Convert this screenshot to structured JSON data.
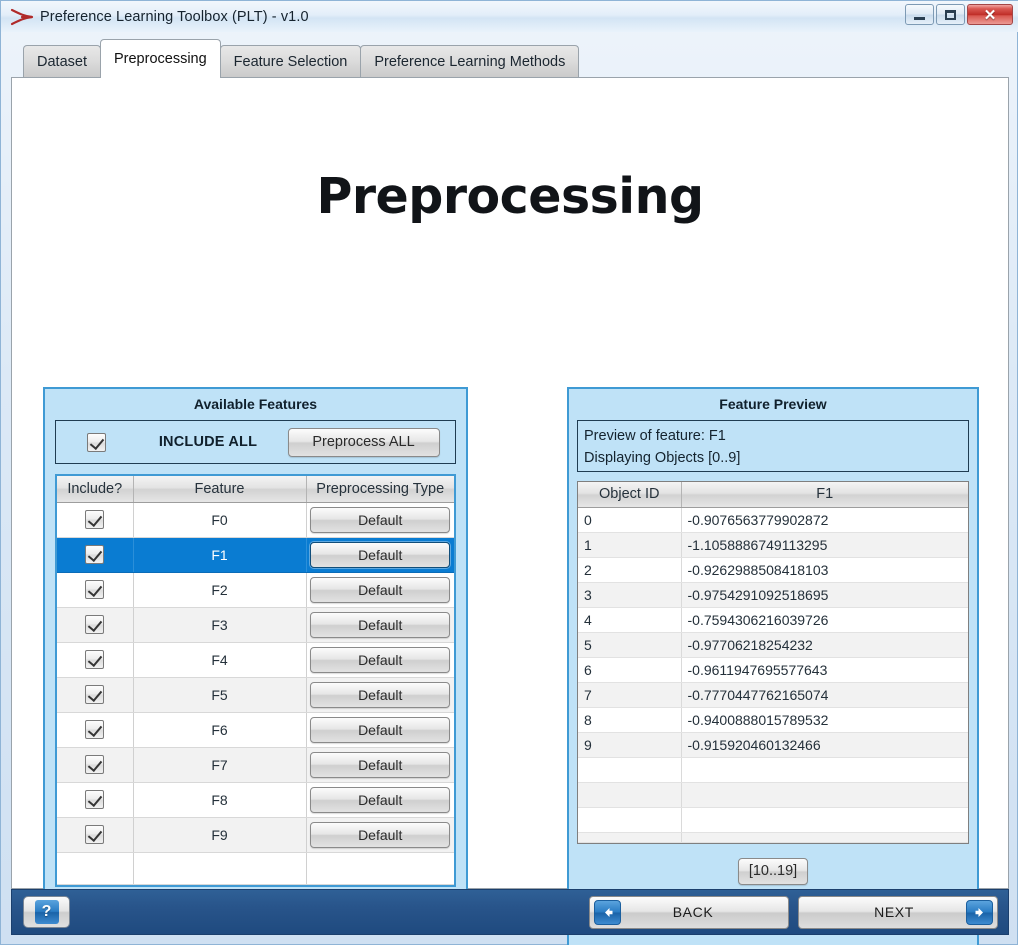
{
  "window": {
    "title": "Preference Learning Toolbox (PLT) - v1.0",
    "app_icon": "plt-logo-icon",
    "controls": {
      "minimize": "minimize-icon",
      "maximize": "maximize-icon",
      "close_label": "✕"
    }
  },
  "tabs": [
    {
      "label": "Dataset",
      "active": false
    },
    {
      "label": "Preprocessing",
      "active": true
    },
    {
      "label": "Feature Selection",
      "active": false
    },
    {
      "label": "Preference Learning Methods",
      "active": false
    }
  ],
  "page": {
    "title": "Preprocessing"
  },
  "available_features": {
    "panel_title": "Available Features",
    "include_all": {
      "checked": true,
      "label": "INCLUDE ALL",
      "button_label": "Preprocess ALL"
    },
    "columns": [
      "Include?",
      "Feature",
      "Preprocessing Type"
    ],
    "rows": [
      {
        "include": true,
        "feature": "F0",
        "type": "Default",
        "selected": false
      },
      {
        "include": true,
        "feature": "F1",
        "type": "Default",
        "selected": true
      },
      {
        "include": true,
        "feature": "F2",
        "type": "Default",
        "selected": false
      },
      {
        "include": true,
        "feature": "F3",
        "type": "Default",
        "selected": false
      },
      {
        "include": true,
        "feature": "F4",
        "type": "Default",
        "selected": false
      },
      {
        "include": true,
        "feature": "F5",
        "type": "Default",
        "selected": false
      },
      {
        "include": true,
        "feature": "F6",
        "type": "Default",
        "selected": false
      },
      {
        "include": true,
        "feature": "F7",
        "type": "Default",
        "selected": false
      },
      {
        "include": true,
        "feature": "F8",
        "type": "Default",
        "selected": false
      },
      {
        "include": true,
        "feature": "F9",
        "type": "Default",
        "selected": false
      }
    ],
    "empty_rows": 1
  },
  "feature_preview": {
    "panel_title": "Feature Preview",
    "info_line_1": "Preview of feature: F1",
    "info_line_2": "Displaying Objects [0..9]",
    "columns": [
      "Object ID",
      "F1"
    ],
    "rows": [
      {
        "id": "0",
        "value": "-0.9076563779902872"
      },
      {
        "id": "1",
        "value": "-1.1058886749113295"
      },
      {
        "id": "2",
        "value": "-0.9262988508418103"
      },
      {
        "id": "3",
        "value": "-0.9754291092518695"
      },
      {
        "id": "4",
        "value": "-0.7594306216039726"
      },
      {
        "id": "5",
        "value": "-0.97706218254232"
      },
      {
        "id": "6",
        "value": "-0.9611947695577643"
      },
      {
        "id": "7",
        "value": "-0.7770447762165074"
      },
      {
        "id": "8",
        "value": "-0.9400888015789532"
      },
      {
        "id": "9",
        "value": "-0.915920460132466"
      }
    ],
    "empty_rows": 4,
    "pager_label": "[10..19]"
  },
  "bottom_bar": {
    "help_label": "?",
    "back_label": "BACK",
    "next_label": "NEXT",
    "back_icon": "arrow-left-icon",
    "next_icon": "arrow-right-icon"
  },
  "colors": {
    "panel_fill": "#bfe2f7",
    "panel_border": "#3f9ad4",
    "selection": "#0a7cd2",
    "bottom_bar": "#28548a",
    "accent_blue": "#2a7cc4",
    "close_red": "#bf2d27"
  }
}
